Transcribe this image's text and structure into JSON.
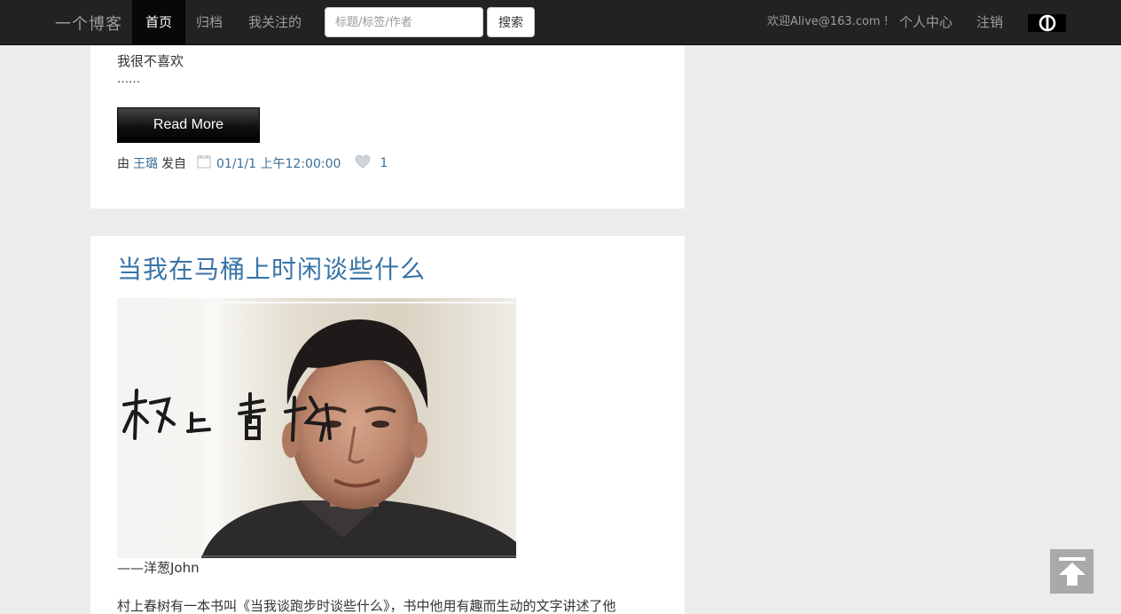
{
  "navbar": {
    "brand": "一个博客",
    "items": [
      {
        "label": "首页",
        "active": true
      },
      {
        "label": "归档",
        "active": false
      },
      {
        "label": "我关注的",
        "active": false
      }
    ],
    "search": {
      "placeholder": "标题/标签/作者",
      "value": "",
      "button_label": "搜索"
    },
    "welcome": "欢迎Alive@163.com !",
    "profile_label": "个人中心",
    "logout_label": "注销",
    "logo_icon": "circle-logo-icon"
  },
  "posts": [
    {
      "excerpt_cut": "",
      "excerpt_line": "我很不喜欢",
      "ellipsis": "……",
      "read_more_label": "Read More",
      "meta": {
        "by_prefix": "由",
        "author": "王璐",
        "by_suffix": "发自",
        "date": "01/1/1 上午12:00:00",
        "likes": "1"
      }
    },
    {
      "title": "当我在马桶上时闲谈些什么",
      "image_alt": "村上春樹 portrait",
      "image_signature": "村上春樹",
      "caption": "——洋葱John",
      "body": "村上春树有一本书叫《当我谈跑步时谈些什么》，书中他用有趣而生动的文字讲述了他"
    }
  ],
  "colors": {
    "navbar_bg": "#222222",
    "active_bg": "#080808",
    "link": "#3a6f9a",
    "title": "#3a74a8",
    "page_bg": "#ececec"
  },
  "icons": {
    "author": "user-icon",
    "date": "calendar-icon",
    "likes": "heart-icon",
    "back_top": "arrow-up-icon"
  }
}
